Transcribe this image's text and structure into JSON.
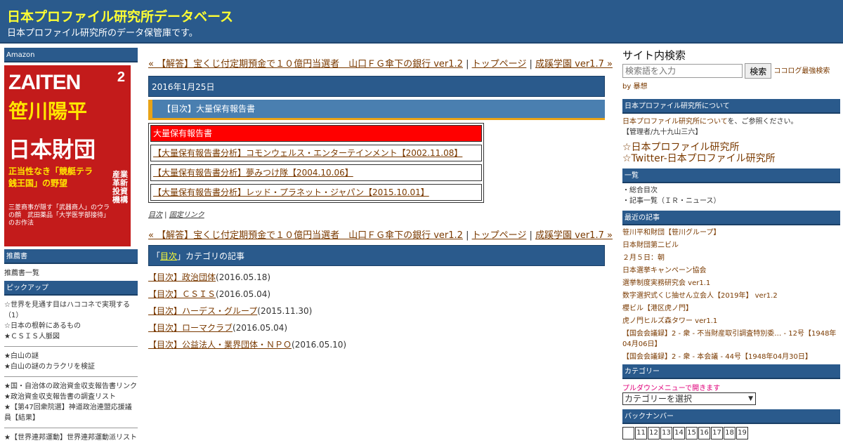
{
  "header": {
    "title": "日本プロファイル研究所データベース",
    "desc": "日本プロファイル研究所のデータ保管庫です。"
  },
  "left": {
    "amazon_title": "Amazon",
    "book": {
      "magazine": "ZAITEN",
      "issue": "2",
      "headline1": "笹川陽平",
      "headline2": "日本財団",
      "sub": "正当性なき「競艇テラ銭王国」の野望",
      "side": "産業革新投資機構",
      "low": "三菱商事が隠す「武器商人」のウラの顔　武田薬品「大学医学部接待」のお作法"
    },
    "rec_title": "推薦書",
    "rec_link": "推薦書一覧",
    "pickup_title": "ピックアップ",
    "pickup_groups": [
      [
        "☆世界を見通す目はハココネで実現する（1）",
        "☆日本の根幹にあるもの",
        "★ＣＳＩＳ人脈図"
      ],
      [
        "★白山の謎",
        "★白山の謎のカラクリを検証"
      ],
      [
        "★国・自治体の政治資金収支報告書リンク",
        "★政治資金収支報告書の調査リスト",
        "★【第47回衆院選】神道政治連盟応援議員【結果】"
      ],
      [
        "★【世界連邦運動】世界連邦運動派リスト"
      ]
    ]
  },
  "main": {
    "nav": {
      "prev": "« 【解答】宝くじ付定期預金で１０億円当選者　山口ＦＧ傘下の銀行 ver1.2",
      "sep": " | ",
      "top": "トップページ",
      "next": "成蹊学園 ver1.7 »"
    },
    "date": "2016年1月25日",
    "post_title": "【目次】大量保有報告書",
    "table": {
      "header": "大量保有報告書",
      "rows": [
        "【大量保有報告書分析】コモンウェルス・エンターテインメント【2002.11.08】",
        "【大量保有報告書分析】夢みつけ隊【2004.10.06】",
        "【大量保有報告書分析】レッド・プラネット・ジャパン【2015.10.01】"
      ]
    },
    "tags": {
      "a": "目次",
      "sep": " | ",
      "b": "固定リンク"
    },
    "cat": {
      "pre": "「",
      "link": "目次",
      "post": "」カテゴリの記事"
    },
    "articles": [
      {
        "title": "【目次】政治団体",
        "date": "(2016.05.18)"
      },
      {
        "title": "【目次】ＣＳＩＳ",
        "date": "(2016.05.04)"
      },
      {
        "title": "【目次】ハーデス・グループ",
        "date": "(2015.11.30)"
      },
      {
        "title": "【目次】ローマクラブ",
        "date": "(2016.05.04)"
      },
      {
        "title": "【目次】公益法人・業界団体・ＮＰＯ",
        "date": "(2016.05.10)"
      }
    ]
  },
  "right": {
    "search_title": "サイト内検索",
    "search_placeholder": "検索語を入力",
    "search_button": "検索",
    "search_by": "ココログ最強検索 by 暴想",
    "about_title": "日本プロファイル研究所について",
    "about_link": "日本プロファイル研究所について",
    "about_rest": "を、ご参照ください。",
    "about_admin": "【管理者/九十九山三六】",
    "links": [
      "☆日本プロファイル研究所",
      "☆Twitter-日本プロファイル研究所"
    ],
    "list_title": "一覧",
    "list_items": [
      "・総合目次",
      "・記事一覧（ＩＲ・ニュース）"
    ],
    "recent_title": "最近の記事",
    "recent": [
      "笹川平和財団【笹川グループ】",
      "日本財団第二ビル",
      "２月５日：朝",
      "日本選挙キャンペーン協会",
      "選挙制度実務研究会 ver1.1",
      "数字選択式くじ抽せん立会人【2019年】 ver1.2",
      "櫻ビル【港区虎ノ門】",
      "虎ノ門ヒルズ森タワー ver1.1",
      "【国会会議録】2 - 衆 - 不当財産取引調査特別委… - 12号【1948年04月06日】",
      "【国会会議録】2 - 衆 - 本会議 - 44号【1948年04月30日】"
    ],
    "category_title": "カテゴリー",
    "category_hint": "プルダウンメニューで開きます",
    "category_select": "カテゴリーを選択",
    "backnum_title": "バックナンバー",
    "backnum": [
      "",
      "11",
      "12",
      "13",
      "14",
      "15",
      "16",
      "17",
      "18",
      "19"
    ]
  }
}
